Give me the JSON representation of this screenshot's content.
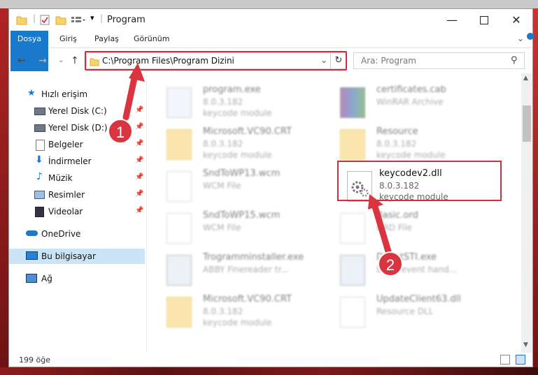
{
  "window": {
    "title": "Program"
  },
  "ribbon": {
    "tabs": [
      "Dosya",
      "Giriş",
      "Paylaş",
      "Görünüm"
    ]
  },
  "address": {
    "path": "C:\\Program Files\\Program Dizini"
  },
  "search": {
    "placeholder": "Ara: Program"
  },
  "sidebar": {
    "items": [
      {
        "label": "Hızlı erişim"
      },
      {
        "label": "Yerel Disk (C:)"
      },
      {
        "label": "Yerel Disk (D:)"
      },
      {
        "label": "Belgeler"
      },
      {
        "label": "İndirmeler"
      },
      {
        "label": "Müzik"
      },
      {
        "label": "Resimler"
      },
      {
        "label": "Videolar"
      },
      {
        "label": "OneDrive"
      },
      {
        "label": "Bu bilgisayar"
      },
      {
        "label": "Ağ"
      }
    ]
  },
  "files": [
    {
      "name": "program.exe",
      "line2": "8.0.3.182",
      "line3": "keycode module"
    },
    {
      "name": "certificates.cab",
      "line2": "WinRAR Archive",
      "line3": ""
    },
    {
      "name": "Microsoft.VC90.CRT",
      "line2": "8.0.3.182",
      "line3": "keycode module"
    },
    {
      "name": "Resource",
      "line2": "8.0.3.182",
      "line3": "keycode module"
    },
    {
      "name": "SndToWP13.wcm",
      "line2": "WCM File",
      "line3": ""
    },
    {
      "name": "keycodev2.dll",
      "line2": "8.0.3.182",
      "line3": "keycode module"
    },
    {
      "name": "SndToWP15.wcm",
      "line2": "WCM File",
      "line3": ""
    },
    {
      "name": "Basic.ord",
      "line2": "ORD File",
      "line3": ""
    },
    {
      "name": "Trogramminstaller.exe",
      "line2": "ABBY Finereader tr...",
      "line3": ""
    },
    {
      "name": "DirectSTI.exe",
      "line2": "Basic event hand...",
      "line3": ""
    },
    {
      "name": "Microsoft.VC90.CRT",
      "line2": "8.0.3.182",
      "line3": "keycode module"
    },
    {
      "name": "UpdateClient63.dll",
      "line2": "Resource DLL",
      "line3": ""
    }
  ],
  "status": {
    "count": "199 öğe"
  },
  "annotations": {
    "step1": "1",
    "step2": "2"
  },
  "colors": {
    "accent": "#1979ca",
    "highlight": "#cf2f3c"
  }
}
